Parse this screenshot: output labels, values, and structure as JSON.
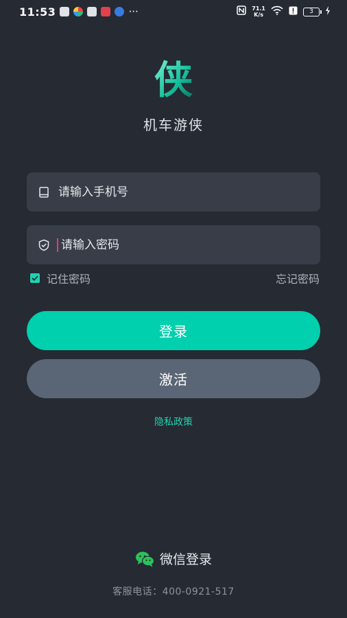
{
  "status_bar": {
    "time": "11:53",
    "more": "···",
    "net_speed_value": "71.1",
    "net_speed_unit": "K/s",
    "battery": "3"
  },
  "app": {
    "logo_glyph": "侠",
    "name": "机车游侠"
  },
  "form": {
    "phone_placeholder": "请输入手机号",
    "password_placeholder": "请输入密码",
    "remember_label": "记住密码",
    "remember_checked": true,
    "forgot_label": "忘记密码"
  },
  "buttons": {
    "login": "登录",
    "activate": "激活"
  },
  "privacy_link": "隐私政策",
  "wechat_login": "微信登录",
  "hotline": "客服电话：400-0921-517",
  "colors": {
    "background": "#252a33",
    "field": "#383d48",
    "accent": "#00d0ae",
    "secondary_button": "#5a6675"
  }
}
